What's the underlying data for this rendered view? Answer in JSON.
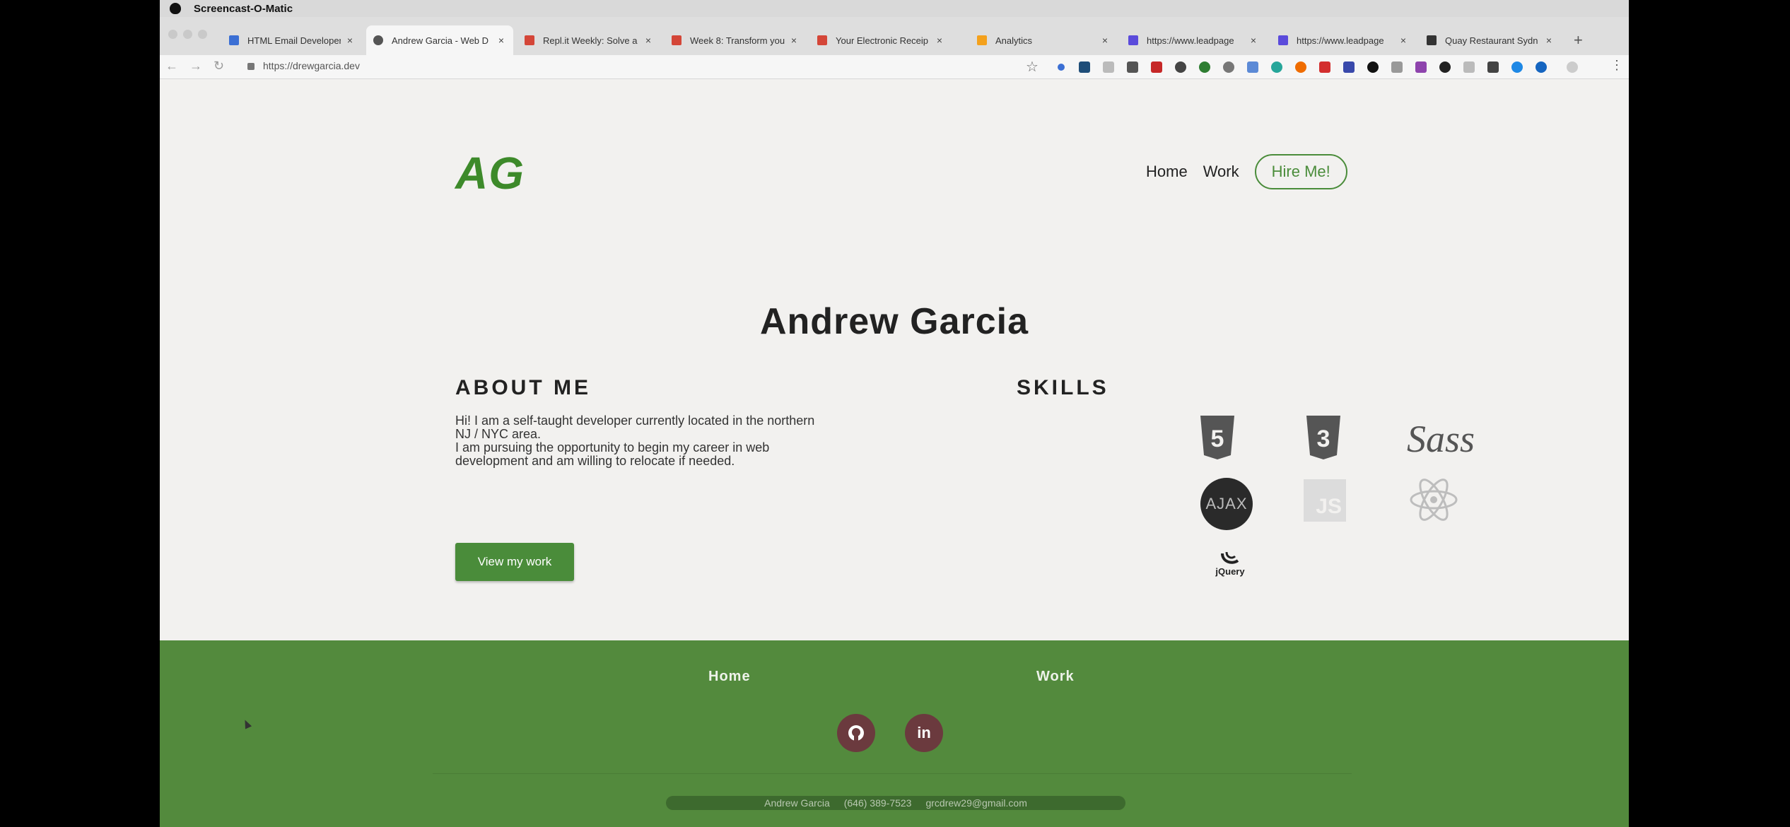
{
  "menubar": {
    "app_name": "Screencast-O-Matic"
  },
  "tabs": [
    {
      "title": "HTML Email Developer",
      "favicon_color": "#3b6fd4"
    },
    {
      "title": "Andrew Garcia - Web D",
      "favicon_color": "#555555"
    },
    {
      "title": "Repl.it Weekly: Solve a",
      "favicon_color": "#d44638"
    },
    {
      "title": "Week 8: Transform you",
      "favicon_color": "#d44638"
    },
    {
      "title": "Your Electronic Receip",
      "favicon_color": "#d44638"
    },
    {
      "title": "Analytics",
      "favicon_color": "#f4a11c"
    },
    {
      "title": "https://www.leadpage",
      "favicon_color": "#5b4bdb"
    },
    {
      "title": "https://www.leadpage",
      "favicon_color": "#5b4bdb"
    },
    {
      "title": "Quay Restaurant Sydn",
      "favicon_color": "#333333"
    }
  ],
  "toolbar": {
    "url": "https://drewgarcia.dev"
  },
  "header": {
    "logo": "AG",
    "nav": {
      "home": "Home",
      "work": "Work",
      "hire": "Hire Me!"
    }
  },
  "hero": {
    "name": "Andrew Garcia"
  },
  "about": {
    "heading": "ABOUT ME",
    "line1": "Hi! I am a self-taught developer currently located in the northern NJ / NYC area.",
    "line2": "I am pursuing the opportunity to begin my career in web development and am willing to relocate if needed.",
    "button": "View my work"
  },
  "skills": {
    "heading": "SKILLS",
    "items": [
      {
        "name": "html5-icon",
        "label": "5"
      },
      {
        "name": "css3-icon",
        "label": "3"
      },
      {
        "name": "sass-icon",
        "label": "Sass"
      },
      {
        "name": "ajax-icon",
        "label": "AJAX"
      },
      {
        "name": "javascript-icon",
        "label": "JS"
      },
      {
        "name": "react-icon",
        "label": ""
      },
      {
        "name": "jquery-icon",
        "label": "jQuery"
      }
    ]
  },
  "footer": {
    "home": "Home",
    "work": "Work",
    "social": {
      "github": "github-icon",
      "linkedin": "in"
    },
    "contact_name": "Andrew Garcia",
    "contact_phone": "(646) 389-7523",
    "contact_email": "grcdrew29@gmail.com"
  }
}
